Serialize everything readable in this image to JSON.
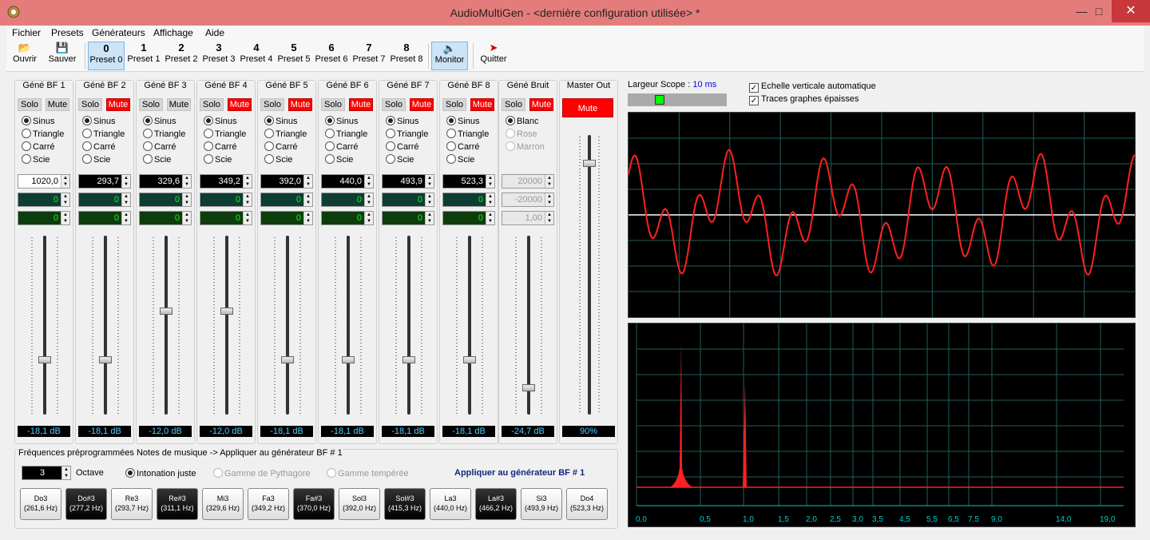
{
  "window": {
    "title": "AudioMultiGen - <dernière configuration utilisée> *"
  },
  "menu": [
    "Fichier",
    "Presets",
    "Générateurs",
    "Affichage",
    "Aide"
  ],
  "toolbar": {
    "open": "Ouvrir",
    "save": "Sauver",
    "presets": [
      {
        "num": "0",
        "label": "Preset 0"
      },
      {
        "num": "1",
        "label": "Preset 1"
      },
      {
        "num": "2",
        "label": "Preset 2"
      },
      {
        "num": "3",
        "label": "Preset 3"
      },
      {
        "num": "4",
        "label": "Preset 4"
      },
      {
        "num": "5",
        "label": "Preset 5"
      },
      {
        "num": "6",
        "label": "Preset 6"
      },
      {
        "num": "7",
        "label": "Preset 7"
      },
      {
        "num": "8",
        "label": "Preset 8"
      }
    ],
    "monitor": "Monitor",
    "quit": "Quitter"
  },
  "common": {
    "solo": "Solo",
    "mute": "Mute",
    "sinus": "Sinus",
    "triangle": "Triangle",
    "carre": "Carré",
    "scie": "Scie"
  },
  "generators": [
    {
      "title": "Géné BF 1",
      "freq": "1020,0",
      "a": "0",
      "b": "0",
      "db": "-18,1 dB",
      "mute": false,
      "level": 0.31
    },
    {
      "title": "Géné BF 2",
      "freq": "293,7",
      "a": "0",
      "b": "0",
      "db": "-18,1 dB",
      "mute": true,
      "level": 0.31
    },
    {
      "title": "Géné BF 3",
      "freq": "329,6",
      "a": "0",
      "b": "0",
      "db": "-12,0 dB",
      "mute": false,
      "level": 0.58
    },
    {
      "title": "Géné BF 4",
      "freq": "349,2",
      "a": "0",
      "b": "0",
      "db": "-12,0 dB",
      "mute": true,
      "level": 0.58
    },
    {
      "title": "Géné BF 5",
      "freq": "392,0",
      "a": "0",
      "b": "0",
      "db": "-18,1 dB",
      "mute": true,
      "level": 0.31
    },
    {
      "title": "Géné BF 6",
      "freq": "440,0",
      "a": "0",
      "b": "0",
      "db": "-18,1 dB",
      "mute": true,
      "level": 0.31
    },
    {
      "title": "Géné BF 7",
      "freq": "493,9",
      "a": "0",
      "b": "0",
      "db": "-18,1 dB",
      "mute": true,
      "level": 0.31
    },
    {
      "title": "Géné BF 8",
      "freq": "523,3",
      "a": "0",
      "b": "0",
      "db": "-18,1 dB",
      "mute": true,
      "level": 0.31
    }
  ],
  "noise": {
    "title": "Géné Bruit",
    "blanc": "Blanc",
    "rose": "Rose",
    "marron": "Marron",
    "v1": "20000",
    "v2": "-20000",
    "v3": "1,00",
    "db": "-24,7 dB",
    "level": 0.15
  },
  "master": {
    "title": "Master Out",
    "mute": "Mute",
    "value": "90%",
    "level": 0.9
  },
  "scope": {
    "label": "Largeur Scope : ",
    "value": "10 ms",
    "auto": "Echelle verticale automatique",
    "thick": "Traces graphes épaisses"
  },
  "spectrum_ticks": [
    "0,0",
    "0,5",
    "1,0",
    "1,5",
    "2,0",
    "2,5",
    "3,0",
    "3,5",
    "4,5",
    "5,5",
    "6,5",
    "7,5",
    "9,0",
    "14,0",
    "19,0"
  ],
  "presets_panel": {
    "title": "Fréquences préprogrammées Notes de musique -> Appliquer au générateur BF # 1",
    "octave_value": "3",
    "octave_label": "Octave",
    "intonation": "Intonation juste",
    "pythagore": "Gamme de Pythagore",
    "temperee": "Gamme tempérée",
    "apply": "Appliquer au générateur BF # 1",
    "notes": [
      {
        "name": "Do3",
        "hz": "(261,6 Hz)",
        "dark": false
      },
      {
        "name": "Do#3",
        "hz": "(277,2 Hz)",
        "dark": true
      },
      {
        "name": "Re3",
        "hz": "(293,7 Hz)",
        "dark": false
      },
      {
        "name": "Re#3",
        "hz": "(311,1 Hz)",
        "dark": true
      },
      {
        "name": "Mi3",
        "hz": "(329,6 Hz)",
        "dark": false
      },
      {
        "name": "Fa3",
        "hz": "(349,2 Hz)",
        "dark": false
      },
      {
        "name": "Fa#3",
        "hz": "(370,0 Hz)",
        "dark": true
      },
      {
        "name": "Sol3",
        "hz": "(392,0 Hz)",
        "dark": false
      },
      {
        "name": "Sol#3",
        "hz": "(415,3 Hz)",
        "dark": true
      },
      {
        "name": "La3",
        "hz": "(440,0 Hz)",
        "dark": false
      },
      {
        "name": "La#3",
        "hz": "(466,2 Hz)",
        "dark": true
      },
      {
        "name": "Si3",
        "hz": "(493,9 Hz)",
        "dark": false
      },
      {
        "name": "Do4",
        "hz": "(523,3 Hz)",
        "dark": false
      }
    ]
  },
  "colors": {
    "trace": "#ff2020",
    "grid": "#1f5f5a",
    "baseline": "#ffffff",
    "title_bar": "#e57c7c"
  }
}
